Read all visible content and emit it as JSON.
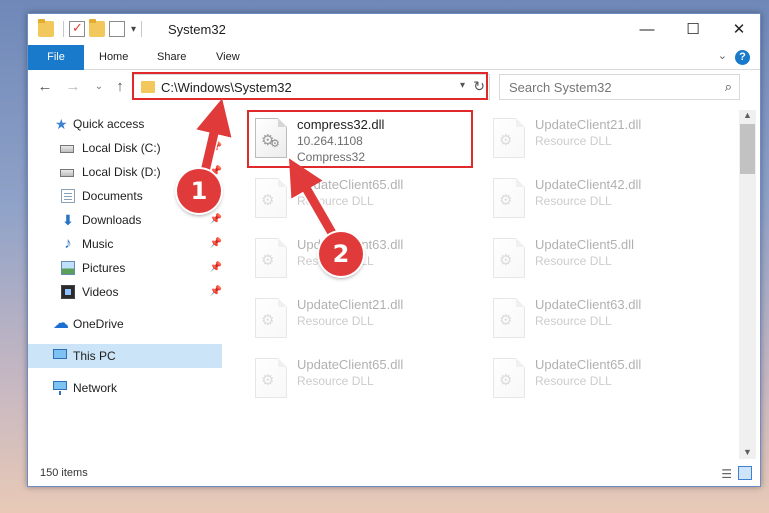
{
  "window": {
    "title": "System32",
    "minimize_icon": "minimize-icon",
    "maximize_icon": "maximize-icon",
    "close_icon": "close-icon"
  },
  "ribbon": {
    "file": "File",
    "home": "Home",
    "share": "Share",
    "view": "View",
    "help": "?"
  },
  "nav": {
    "address": "C:\\Windows\\System32",
    "search_placeholder": "Search System32"
  },
  "sidebar": {
    "items": [
      {
        "label": "Quick access",
        "icon": "star-icon"
      },
      {
        "label": "Local Disk (C:)",
        "icon": "drive-icon"
      },
      {
        "label": "Local Disk (D:)",
        "icon": "drive-icon"
      },
      {
        "label": "Documents",
        "icon": "documents-icon"
      },
      {
        "label": "Downloads",
        "icon": "downloads-icon"
      },
      {
        "label": "Music",
        "icon": "music-icon"
      },
      {
        "label": "Pictures",
        "icon": "pictures-icon"
      },
      {
        "label": "Videos",
        "icon": "videos-icon"
      },
      {
        "label": "OneDrive",
        "icon": "cloud-icon"
      },
      {
        "label": "This PC",
        "icon": "computer-icon"
      },
      {
        "label": "Network",
        "icon": "network-icon"
      }
    ]
  },
  "files": [
    {
      "name": "compress32.dll",
      "line2": "10.264.1108",
      "line3": "Compress32"
    },
    {
      "name": "UpdateClient21.dll",
      "line2": "Resource DLL"
    },
    {
      "name": "UpdateClient65.dll",
      "line2": "Resource DLL"
    },
    {
      "name": "UpdateClient42.dll",
      "line2": "Resource DLL"
    },
    {
      "name": "UpdateClient63.dll",
      "line2": "Resource DLL"
    },
    {
      "name": "UpdateClient5.dll",
      "line2": "Resource DLL"
    },
    {
      "name": "UpdateClient21.dll",
      "line2": "Resource DLL"
    },
    {
      "name": "UpdateClient63.dll",
      "line2": "Resource DLL"
    },
    {
      "name": "UpdateClient65.dll",
      "line2": "Resource DLL"
    },
    {
      "name": "UpdateClient65.dll",
      "line2": "Resource DLL"
    }
  ],
  "status": {
    "count": "150 items"
  },
  "annotations": {
    "step1": "1",
    "step2": "2",
    "color": "#e02a2a"
  }
}
